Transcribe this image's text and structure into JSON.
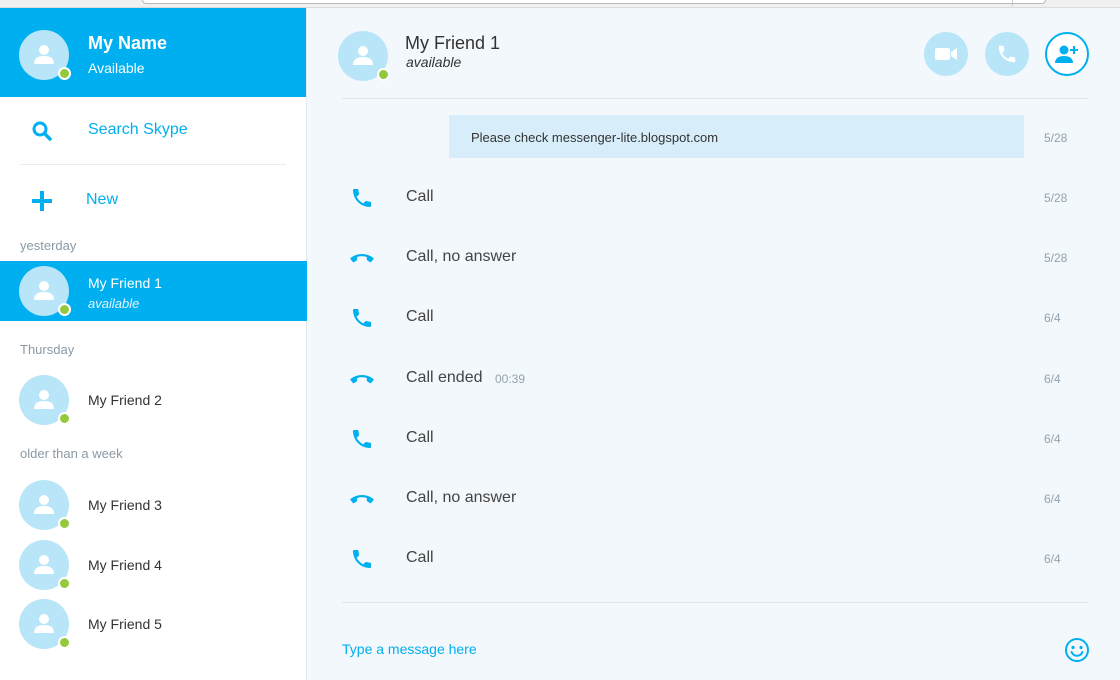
{
  "me": {
    "name": "My Name",
    "status": "Available"
  },
  "sidebar": {
    "search_label": "Search Skype",
    "new_label": "New",
    "groups": {
      "yesterday": "yesterday",
      "thursday": "Thursday",
      "older": "older than a week"
    },
    "contacts": [
      {
        "name": "My Friend 1",
        "status": "available",
        "active": true
      },
      {
        "name": "My Friend 2"
      },
      {
        "name": "My Friend 3"
      },
      {
        "name": "My Friend 4"
      },
      {
        "name": "My Friend 5"
      }
    ]
  },
  "chat": {
    "name": "My Friend 1",
    "status": "available",
    "message": {
      "text": "Please check messenger-lite.blogspot.com",
      "date": "5/28"
    },
    "calls": [
      {
        "label": "Call",
        "icon": "phone-icon",
        "date": "5/28"
      },
      {
        "label": "Call, no answer",
        "icon": "hangup-icon",
        "date": "5/28"
      },
      {
        "label": "Call",
        "icon": "phone-icon",
        "date": "6/4"
      },
      {
        "label": "Call ended",
        "duration": "00:39",
        "icon": "hangup-icon",
        "date": "6/4"
      },
      {
        "label": "Call",
        "icon": "phone-icon",
        "date": "6/4"
      },
      {
        "label": "Call, no answer",
        "icon": "hangup-icon",
        "date": "6/4"
      },
      {
        "label": "Call",
        "icon": "phone-icon",
        "date": "6/4"
      }
    ],
    "compose_placeholder": "Type a message here"
  },
  "colors": {
    "accent": "#00aff0",
    "presence": "#94c83d",
    "avatar": "#b8e5f8"
  }
}
